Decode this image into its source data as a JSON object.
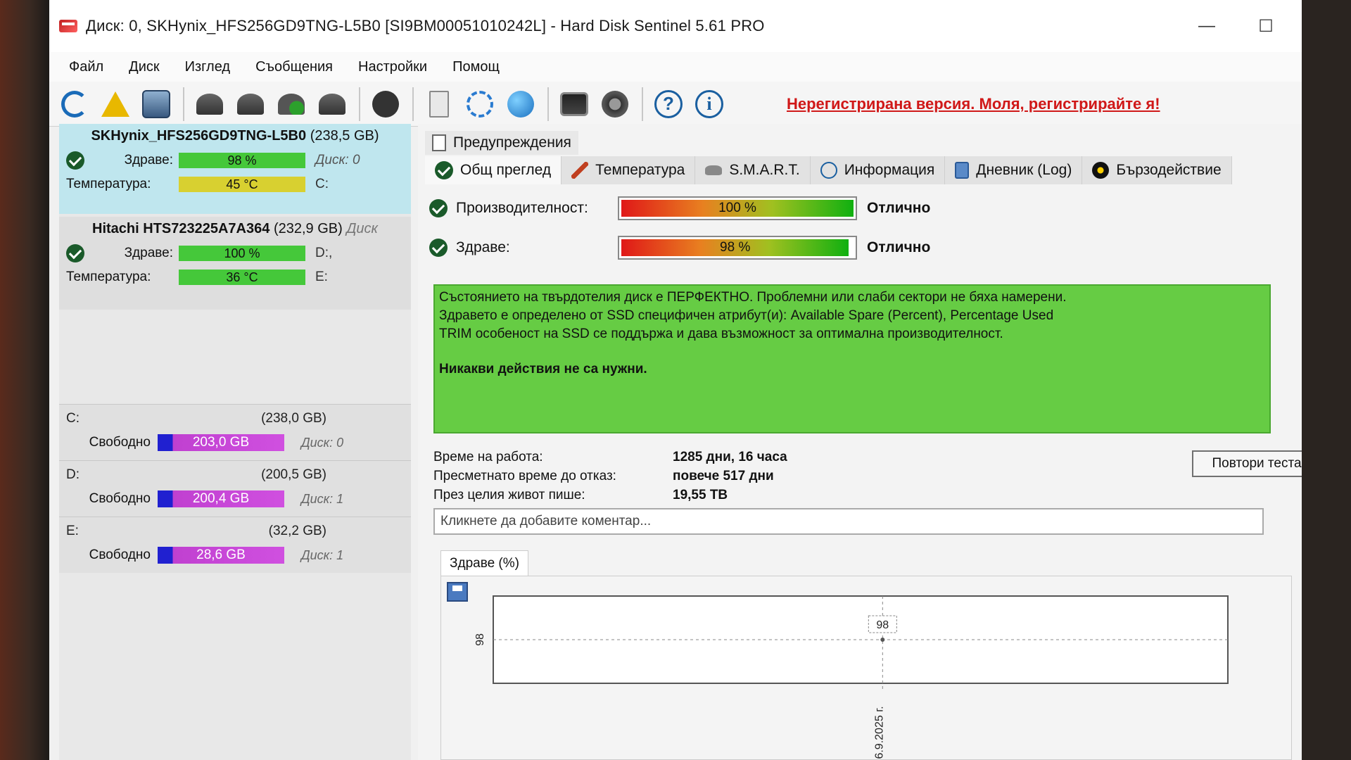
{
  "window": {
    "title": "Диск: 0, SKHynix_HFS256GD9TNG-L5B0 [SI9BM00051010242L]  -  Hard Disk Sentinel 5.61 PRO",
    "controls": {
      "minimize": "—",
      "maximize": "☐",
      "close": "✕"
    }
  },
  "menu": [
    "Файл",
    "Диск",
    "Изглед",
    "Съобщения",
    "Настройки",
    "Помощ"
  ],
  "toolbar": {
    "icons": [
      "refresh-icon",
      "warning-icon",
      "disk-icon",
      "dish-icon",
      "dish-down-icon",
      "dish-check-icon",
      "dish-back-icon",
      "blob-icon",
      "document-icon",
      "sync-icon",
      "globe-icon",
      "monitor-icon",
      "speaker-icon",
      "help-icon",
      "info-icon"
    ],
    "help_glyph": "?",
    "info_glyph": "i",
    "unregistered": "Нерегистрирана версия. Моля, регистрирайте я!"
  },
  "disks": [
    {
      "name": "SKHynix_HFS256GD9TNG-L5B0",
      "size": "(238,5 GB)",
      "health_label": "Здраве:",
      "health": "98 %",
      "health_disk": "Диск: 0",
      "temp_label": "Температура:",
      "temp": "45 °C",
      "temp_extra": "C:"
    },
    {
      "name": "Hitachi HTS723225A7A364",
      "size": "(232,9 GB)",
      "size_extra": "Диск",
      "health_label": "Здраве:",
      "health": "100 %",
      "health_disk": "D:,",
      "temp_label": "Температура:",
      "temp": "36 °C",
      "temp_extra": "E:"
    }
  ],
  "partitions": [
    {
      "letter": "C:",
      "size": "(238,0 GB)",
      "free_label": "Свободно",
      "free": "203,0 GB",
      "disk": "Диск: 0"
    },
    {
      "letter": "D:",
      "size": "(200,5 GB)",
      "free_label": "Свободно",
      "free": "200,4 GB",
      "disk": "Диск: 1"
    },
    {
      "letter": "E:",
      "size": "(32,2 GB)",
      "free_label": "Свободно",
      "free": "28,6 GB",
      "disk": "Диск: 1"
    }
  ],
  "tabs": {
    "warnings": "Предупреждения",
    "items": [
      "Общ преглед",
      "Температура",
      "S.M.A.R.T.",
      "Информация",
      "Дневник (Log)",
      "Бързодействие"
    ]
  },
  "overview": {
    "performance_label": "Производителност:",
    "performance_value": "100 %",
    "performance_fraction": 1.0,
    "performance_result": "Отлично",
    "health_label": "Здраве:",
    "health_value": "98 %",
    "health_fraction": 0.98,
    "health_result": "Отлично",
    "message_lines": [
      "Състоянието на твърдотелия диск е ПЕРФЕКТНО. Проблемни или слаби сектори не бяха намерени.",
      "Здравето е определено от SSD специфичен атрибут(и):  Available Spare (Percent), Percentage Used",
      "TRIM особеност на SSD се поддържа и дава възможност за оптимална производителност."
    ],
    "message_bold": "Никакви действия не са нужни.",
    "help_glyph": "?"
  },
  "info": [
    {
      "k": "Време на работа:",
      "v": "1285 дни, 16 часа"
    },
    {
      "k": "Пресметнато време до отказ:",
      "v": "повече 517 дни"
    },
    {
      "k": "През целия живот пише:",
      "v": "19,55 TB"
    }
  ],
  "retest_button": "Повтори теста",
  "comment_placeholder": "Кликнете да добавите коментар...",
  "chart_tab": "Здраве (%)",
  "chart_data": {
    "type": "line",
    "x": [
      "6.9.2025 г."
    ],
    "series": [
      {
        "values": [
          98
        ]
      }
    ],
    "ytick_labels": [
      "98"
    ],
    "point_labels": [
      "98"
    ],
    "colors": {
      "line": "#555555"
    }
  }
}
